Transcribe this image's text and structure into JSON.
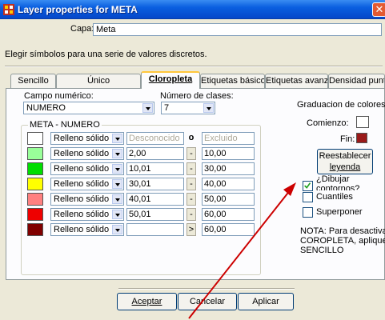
{
  "window": {
    "title": "Layer properties for META",
    "close_glyph": "✕"
  },
  "header": {
    "capa_label": "Capa:",
    "capa_value": "Meta",
    "description": "Elegir símbolos para una serie de valores discretos."
  },
  "tabs": [
    {
      "label": "Sencillo",
      "active": false
    },
    {
      "label": "Único",
      "active": false
    },
    {
      "label": "Cloropleta",
      "active": true
    },
    {
      "label": "Etiquetas básico",
      "active": false
    },
    {
      "label": "Etiquetas avanz.",
      "active": false
    },
    {
      "label": "Densidad puntos",
      "active": false
    }
  ],
  "form": {
    "field_label": "Campo numérico:",
    "field_value": "NUMERO",
    "classes_label": "Número de clases:",
    "classes_value": "7"
  },
  "group": {
    "title": "META - NUMERO",
    "rows": [
      {
        "color": "#ffffff",
        "fill": "Relleno sólido",
        "from": "Desconocido",
        "op": "o",
        "to": "Excluido",
        "disabled": true
      },
      {
        "color": "#99ff99",
        "fill": "Relleno sólido",
        "from": "2,00",
        "op": "-",
        "to": "10,00",
        "disabled": false
      },
      {
        "color": "#00dd00",
        "fill": "Relleno sólido",
        "from": "10,01",
        "op": "-",
        "to": "30,00",
        "disabled": false
      },
      {
        "color": "#ffff00",
        "fill": "Relleno sólido",
        "from": "30,01",
        "op": "-",
        "to": "40,00",
        "disabled": false
      },
      {
        "color": "#ff8080",
        "fill": "Relleno sólido",
        "from": "40,01",
        "op": "-",
        "to": "50,00",
        "disabled": false
      },
      {
        "color": "#ee0000",
        "fill": "Relleno sólido",
        "from": "50,01",
        "op": "-",
        "to": "60,00",
        "disabled": false
      },
      {
        "color": "#800000",
        "fill": "Relleno sólido",
        "from": "",
        "op": ">",
        "to": "60,00",
        "disabled": false
      }
    ]
  },
  "gradient": {
    "title": "Graduacion de colores",
    "start_label": "Comienzo:",
    "start_color": "#ffffff",
    "end_label": "Fin:",
    "end_color": "#9a1a1a",
    "reset_label_line1": "Reestablecer",
    "reset_label_line2": "leyenda"
  },
  "options": {
    "outline_label_line1": "¿Dibujar",
    "outline_label_line2": "contornos?",
    "outline_checked": true,
    "quantiles_label": "Cuantiles",
    "quantiles_checked": false,
    "overlay_label": "Superponer",
    "overlay_checked": false
  },
  "note": {
    "line1": "NOTA: Para desactivar",
    "line2": "COROPLETA, aplique",
    "line3": "SENCILLO"
  },
  "footer": {
    "ok_label": "Aceptar",
    "cancel_label": "Cancelar",
    "apply_label": "Aplicar"
  },
  "colors": {
    "titlebar": "#0a5fe0",
    "annotation_arrow": "#cc0000",
    "active_tab_highlight": "#ffc73c"
  },
  "icons": {
    "app": "app-icon",
    "close": "close-icon",
    "dropdown": "chevron-down-icon",
    "checkmark": "check-icon"
  }
}
